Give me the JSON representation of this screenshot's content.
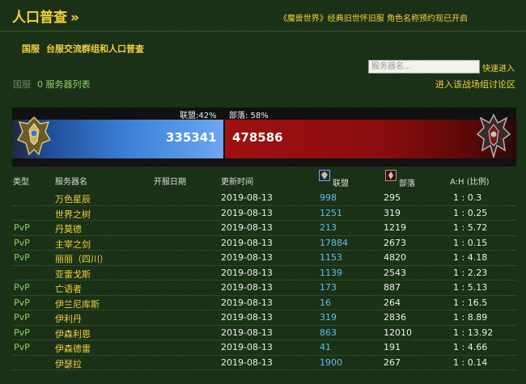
{
  "header": {
    "title": "人口普查",
    "title_suffix": "»",
    "notice": "《魔兽世界》经典旧世怀旧服 角色名称预约现已开启"
  },
  "region": {
    "name": "国服",
    "subtitle": "台服交流群组和人口普查"
  },
  "search": {
    "placeholder": "服务器名...",
    "button": "快速进入"
  },
  "nav": {
    "region_label": "国服",
    "server_list": "0 服务器列表",
    "discuss_link": "进入该战场组讨论区"
  },
  "faction_bar": {
    "alliance_label": "联盟:42%",
    "horde_label": "部落: 58%",
    "alliance_total": "335341",
    "horde_total": "478586",
    "alliance_color": "#3d80d8",
    "horde_color": "#a01010",
    "alliance_percent": 42,
    "horde_percent": 58
  },
  "table": {
    "headers": {
      "type": "类型",
      "name": "服务器名",
      "open_date": "开服日期",
      "update_time": "更新时间",
      "alliance": "联盟",
      "horde": "部落",
      "ratio": "A:H (比例)"
    },
    "rows": [
      {
        "type": "",
        "name": "万色星辰",
        "date": "2019-08-13",
        "alliance": "998",
        "horde": "295",
        "ratio": "1 : 0.3"
      },
      {
        "type": "",
        "name": "世界之树",
        "date": "2019-08-13",
        "alliance": "1251",
        "horde": "319",
        "ratio": "1 : 0.25"
      },
      {
        "type": "PvP",
        "name": "丹莫德",
        "date": "2019-08-13",
        "alliance": "213",
        "horde": "1219",
        "ratio": "1 : 5.72"
      },
      {
        "type": "PvP",
        "name": "主宰之剑",
        "date": "2019-08-13",
        "alliance": "17884",
        "horde": "2673",
        "ratio": "1 : 0.15"
      },
      {
        "type": "PvP",
        "name": "丽丽（四川）",
        "date": "2019-08-13",
        "alliance": "1153",
        "horde": "4820",
        "ratio": "1 : 4.18"
      },
      {
        "type": "",
        "name": "亚雷戈斯",
        "date": "2019-08-13",
        "alliance": "1139",
        "horde": "2543",
        "ratio": "1 : 2.23"
      },
      {
        "type": "PvP",
        "name": "亡语者",
        "date": "2019-08-13",
        "alliance": "173",
        "horde": "887",
        "ratio": "1 : 5.13"
      },
      {
        "type": "PvP",
        "name": "伊兰尼库斯",
        "date": "2019-08-13",
        "alliance": "16",
        "horde": "264",
        "ratio": "1 : 16.5"
      },
      {
        "type": "PvP",
        "name": "伊利丹",
        "date": "2019-08-13",
        "alliance": "319",
        "horde": "2836",
        "ratio": "1 : 8.89"
      },
      {
        "type": "PvP",
        "name": "伊森利恩",
        "date": "2019-08-13",
        "alliance": "863",
        "horde": "12010",
        "ratio": "1 : 13.92"
      },
      {
        "type": "PvP",
        "name": "伊森德雷",
        "date": "2019-08-13",
        "alliance": "41",
        "horde": "191",
        "ratio": "1 : 4.66"
      },
      {
        "type": "",
        "name": "伊瑟拉",
        "date": "2019-08-13",
        "alliance": "1900",
        "horde": "267",
        "ratio": "1 : 0.14"
      }
    ]
  }
}
